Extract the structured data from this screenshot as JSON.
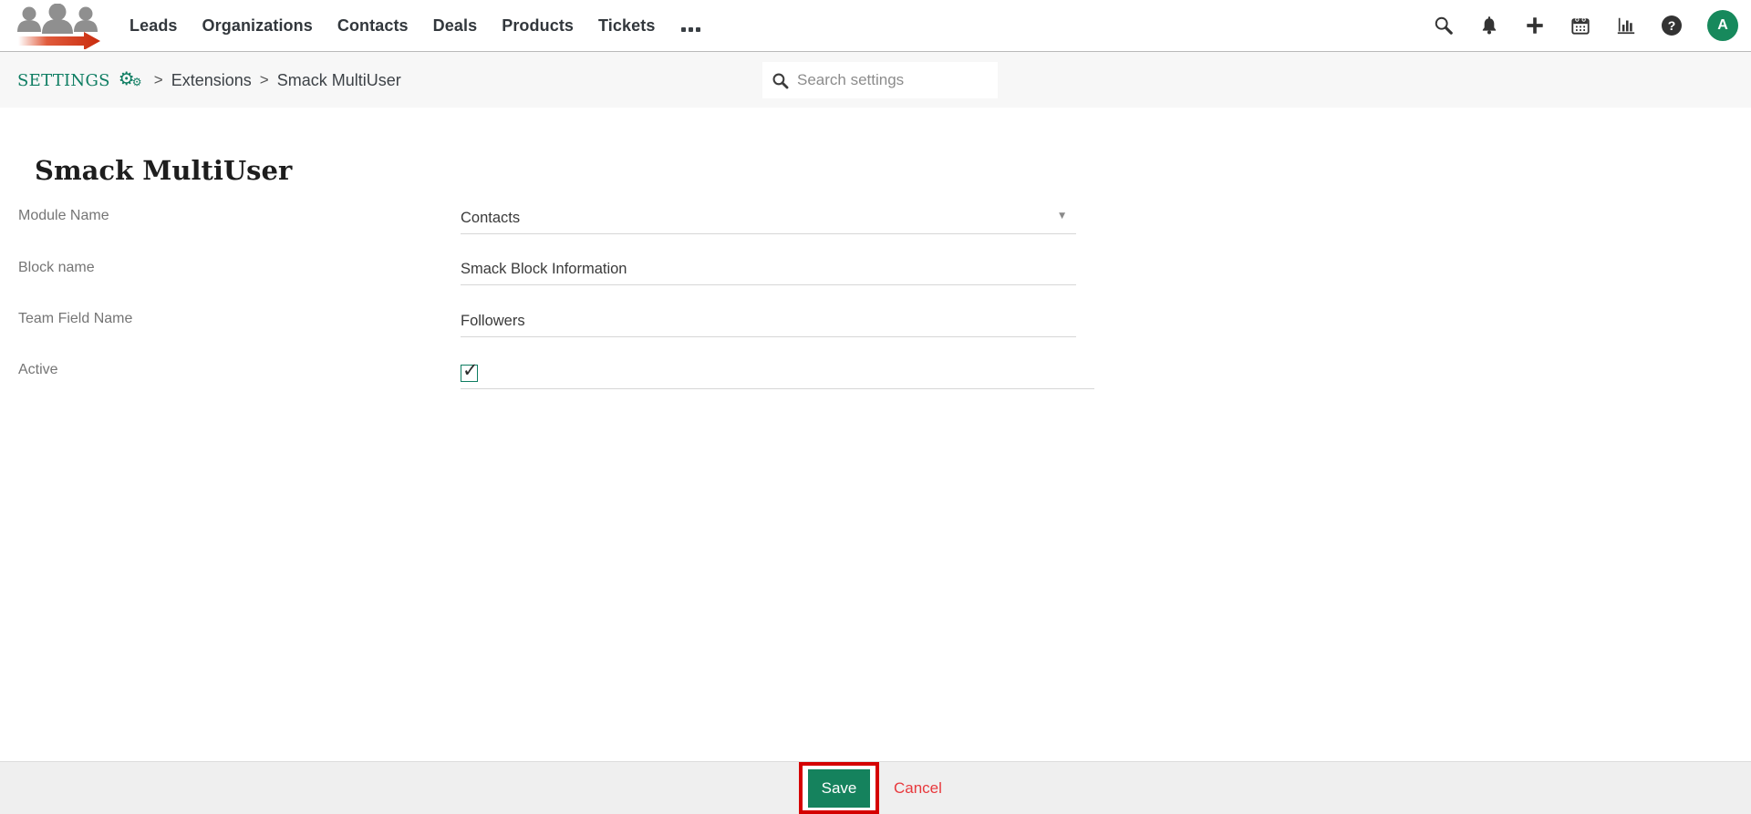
{
  "nav": {
    "menu_items": [
      "Leads",
      "Organizations",
      "Contacts",
      "Deals",
      "Products",
      "Tickets"
    ],
    "avatar_initial": "A",
    "icon_names": [
      "search-icon",
      "notifications-icon",
      "add-icon",
      "calendar-icon",
      "reports-icon",
      "help-icon",
      "user-avatar"
    ]
  },
  "breadcrumb": {
    "settings_label": "SETTINGS",
    "separator": ">",
    "items": [
      "Extensions",
      "Smack MultiUser"
    ]
  },
  "search": {
    "placeholder": "Search settings"
  },
  "page": {
    "title": "Smack MultiUser"
  },
  "form": {
    "fields": [
      {
        "label": "Module Name",
        "value": "Contacts",
        "type": "select"
      },
      {
        "label": "Block name",
        "value": "Smack Block Information",
        "type": "text"
      },
      {
        "label": "Team Field Name",
        "value": "Followers",
        "type": "text"
      },
      {
        "label": "Active",
        "type": "checkbox",
        "checked": true
      }
    ]
  },
  "footer": {
    "save_label": "Save",
    "cancel_label": "Cancel"
  },
  "glyphs": {
    "help": "?",
    "check": "✓",
    "dropdown": "▼",
    "gear": "⚙"
  },
  "colors": {
    "brand_green": "#0e7d62",
    "save_green": "#15825d",
    "annotation_red": "#d50000",
    "cancel_red": "#e8393d",
    "avatar_green": "#17895c"
  }
}
